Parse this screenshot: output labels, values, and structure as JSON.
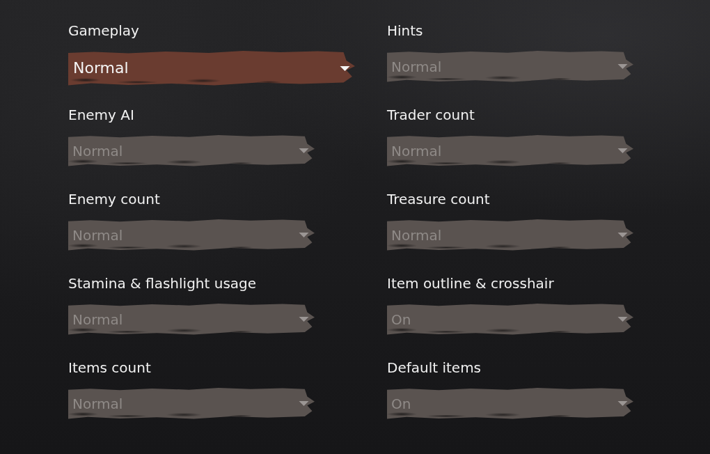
{
  "settings": [
    {
      "label": "Gameplay",
      "value": "Normal",
      "selected": true,
      "disabled": false
    },
    {
      "label": "Hints",
      "value": "Normal",
      "selected": false,
      "disabled": true
    },
    {
      "label": "Enemy AI",
      "value": "Normal",
      "selected": false,
      "disabled": true
    },
    {
      "label": "Trader count",
      "value": "Normal",
      "selected": false,
      "disabled": true
    },
    {
      "label": "Enemy count",
      "value": "Normal",
      "selected": false,
      "disabled": true
    },
    {
      "label": "Treasure count",
      "value": "Normal",
      "selected": false,
      "disabled": true
    },
    {
      "label": "Stamina & flashlight usage",
      "value": "Normal",
      "selected": false,
      "disabled": true
    },
    {
      "label": "Item outline & crosshair",
      "value": "On",
      "selected": false,
      "disabled": true
    },
    {
      "label": "Items count",
      "value": "Normal",
      "selected": false,
      "disabled": true
    },
    {
      "label": "Default items",
      "value": "On",
      "selected": false,
      "disabled": true
    }
  ]
}
